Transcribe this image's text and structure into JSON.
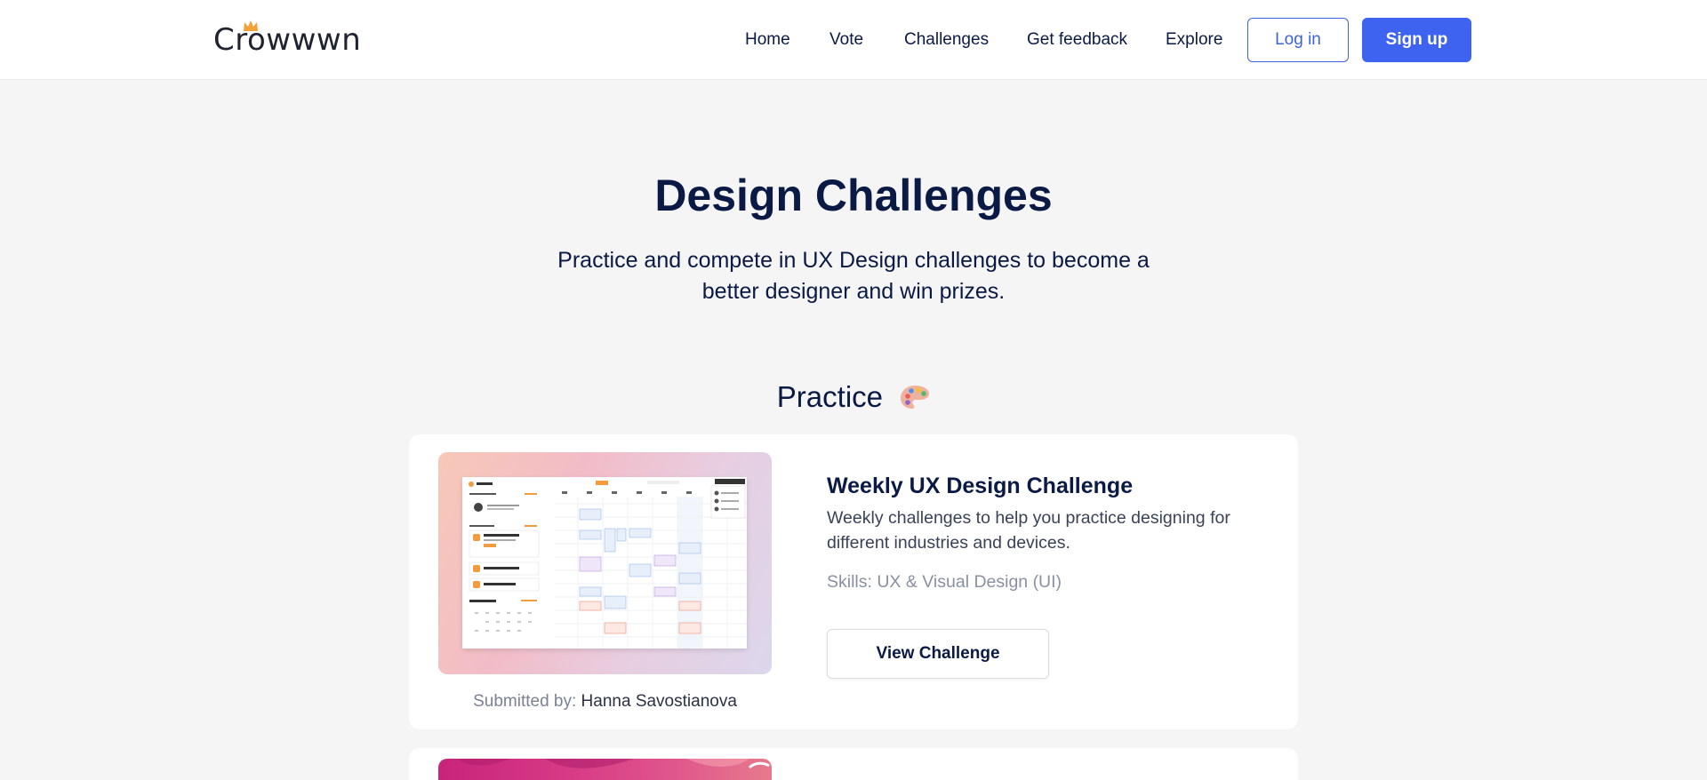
{
  "header": {
    "logo": "Crowwwn",
    "nav": [
      "Home",
      "Vote",
      "Challenges",
      "Get feedback",
      "Explore"
    ],
    "login_label": "Log in",
    "signup_label": "Sign up"
  },
  "hero": {
    "title": "Design Challenges",
    "subtitle": "Practice and compete in UX Design challenges to become a better designer and win prizes."
  },
  "practice": {
    "title": "Practice",
    "icon": "palette-icon",
    "cards": [
      {
        "title": "Weekly UX Design Challenge",
        "description": "Weekly challenges to help you practice designing for different industries and devices.",
        "skills": "Skills: UX & Visual Design (UI)",
        "button_label": "View Challenge",
        "submitted_label": "Submitted by:",
        "submitted_by": "Hanna Savostianova"
      }
    ]
  },
  "colors": {
    "primary": "#3e63f0",
    "text_dark": "#0b1a45",
    "background": "#f5f5f6"
  }
}
